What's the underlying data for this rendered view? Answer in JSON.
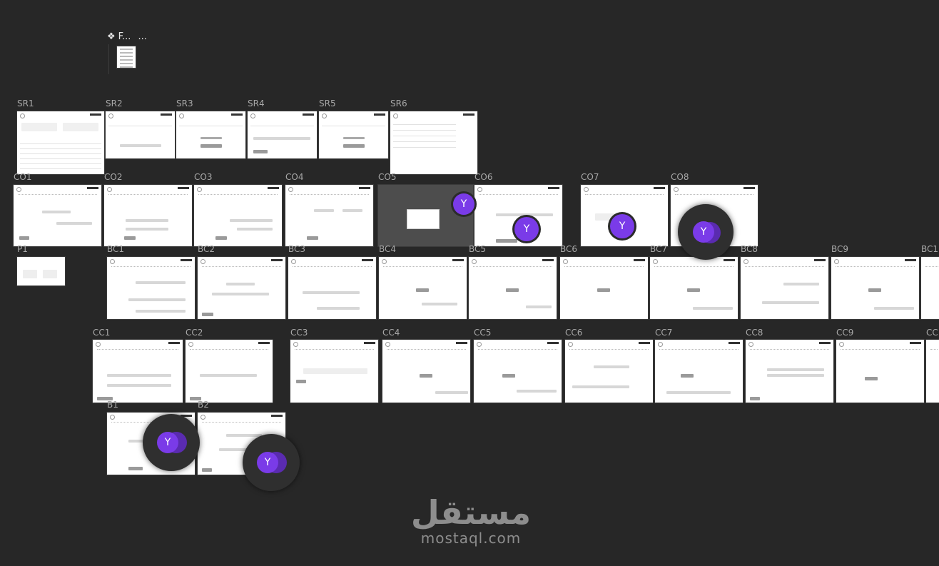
{
  "component": {
    "icon": "component-diamond-icon",
    "name": "F...",
    "more": "..."
  },
  "frames": [
    {
      "label": "SR1"
    },
    {
      "label": "SR2"
    },
    {
      "label": "SR3"
    },
    {
      "label": "SR4"
    },
    {
      "label": "SR5"
    },
    {
      "label": "SR6"
    },
    {
      "label": "CO1"
    },
    {
      "label": "CO2"
    },
    {
      "label": "CO3"
    },
    {
      "label": "CO4"
    },
    {
      "label": "CO5"
    },
    {
      "label": "CO6"
    },
    {
      "label": "CO7"
    },
    {
      "label": "CO8"
    },
    {
      "label": "P1"
    },
    {
      "label": "BC1"
    },
    {
      "label": "BC2"
    },
    {
      "label": "BC3"
    },
    {
      "label": "BC4"
    },
    {
      "label": "BC5"
    },
    {
      "label": "BC6"
    },
    {
      "label": "BC7"
    },
    {
      "label": "BC8"
    },
    {
      "label": "BC9"
    },
    {
      "label": "BC1"
    },
    {
      "label": "CC1"
    },
    {
      "label": "CC2"
    },
    {
      "label": "CC3"
    },
    {
      "label": "CC4"
    },
    {
      "label": "CC5"
    },
    {
      "label": "CC6"
    },
    {
      "label": "CC7"
    },
    {
      "label": "CC8"
    },
    {
      "label": "CC9"
    },
    {
      "label": "CC"
    },
    {
      "label": "B1"
    },
    {
      "label": "B2"
    }
  ],
  "cursors": [
    {
      "initial": "Y",
      "color": "#7a3be8"
    },
    {
      "initial": "Y",
      "color": "#7a3be8"
    },
    {
      "initial": "Y",
      "color": "#7a3be8"
    },
    {
      "initial": "Y",
      "color": "#7a3be8"
    },
    {
      "initial": "Y",
      "color": "#7a3be8"
    },
    {
      "initial": "Y",
      "color": "#7a3be8"
    }
  ],
  "watermark": {
    "arabic": "مستقل",
    "latin": "mostaql.com"
  }
}
